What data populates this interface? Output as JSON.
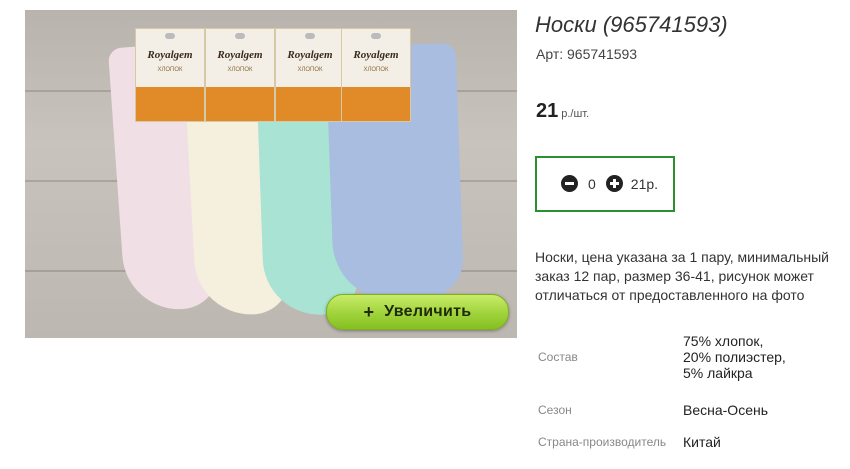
{
  "product": {
    "title": "Носки (965741593)",
    "article": "Арт: 965741593",
    "price_value": "21",
    "price_unit": "р./шт.",
    "description": "Носки, цена указана за 1 пару, минимальный заказ 12 пар, размер 36-41, рисунок может отличаться от предоставленного на фото"
  },
  "image": {
    "zoom_button_plus": "+",
    "zoom_button_label": "Увеличить",
    "tag_brand": "Royalgem",
    "tag_material": "ХЛОПОК",
    "sock_colors": [
      "#f1dfe6",
      "#f5efdd",
      "#a8e3d3",
      "#a9bde0"
    ]
  },
  "cart": {
    "quantity": "0",
    "sum": "21р.",
    "minus_icon": "minus-circle-icon",
    "plus_icon": "plus-circle-icon",
    "border_color": "#2f8f2f"
  },
  "specs": [
    {
      "key": "Состав",
      "value": "75% хлопок, 20% полиэстер, 5% лайкра"
    },
    {
      "key": "Сезон",
      "value": "Весна-Осень"
    },
    {
      "key": "Страна-производитель",
      "value": "Китай"
    }
  ]
}
